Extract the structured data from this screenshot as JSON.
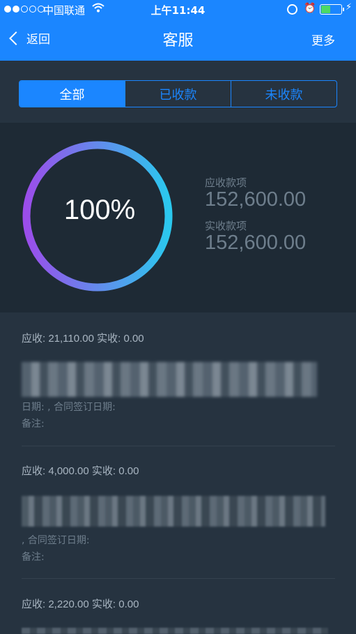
{
  "status_bar": {
    "carrier": "中国联通",
    "time": "上午11:44",
    "signal_bars": 2,
    "battery_level": 0.45
  },
  "nav": {
    "back_label": "返回",
    "title": "客服",
    "more_label": "更多"
  },
  "tabs": [
    {
      "label": "全部",
      "active": true
    },
    {
      "label": "已收款",
      "active": false
    },
    {
      "label": "未收款",
      "active": false
    }
  ],
  "summary": {
    "percent_text": "100%",
    "percent_value": 100,
    "receivable_label": "应收款项",
    "receivable_value": "152,600.00",
    "received_label": "实收款项",
    "received_value": "152,600.00"
  },
  "records": [
    {
      "amounts": "应收: 21,110.00 实收: 0.00",
      "date_line": "日期: , 合同签订日期:",
      "note_line": "备注:"
    },
    {
      "amounts": "应收: 4,000.00 实收: 0.00",
      "date_line": ", 合同签订日期:",
      "note_line": "备注:"
    },
    {
      "amounts": "应收: 2,220.00 实收: 0.00"
    }
  ],
  "colors": {
    "accent": "#1b86ff",
    "background": "#263340",
    "panel": "#1e2a35",
    "ring_start": "#9b4dea",
    "ring_end": "#2bc8ee"
  }
}
